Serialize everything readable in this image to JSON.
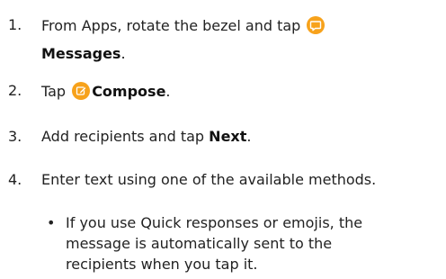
{
  "steps": [
    {
      "number": "1.",
      "text_before": "From Apps, rotate the bezel and tap",
      "icon": "messages-icon",
      "bold_label": "Messages",
      "text_after": "."
    },
    {
      "number": "2.",
      "text_before": "Tap",
      "icon": "compose-icon",
      "bold_label": "Compose",
      "text_after": "."
    },
    {
      "number": "3.",
      "text_before": "Add recipients and tap",
      "bold_label": "Next",
      "text_after": "."
    },
    {
      "number": "4.",
      "text_before": "Enter text using one of the available methods."
    }
  ],
  "sub_bullet": {
    "lines": [
      "If you use Quick responses or emojis, the",
      "message is automatically sent to the",
      "recipients when you tap it."
    ]
  },
  "colors": {
    "icon_background": "#f7a21b",
    "text": "#222222"
  }
}
